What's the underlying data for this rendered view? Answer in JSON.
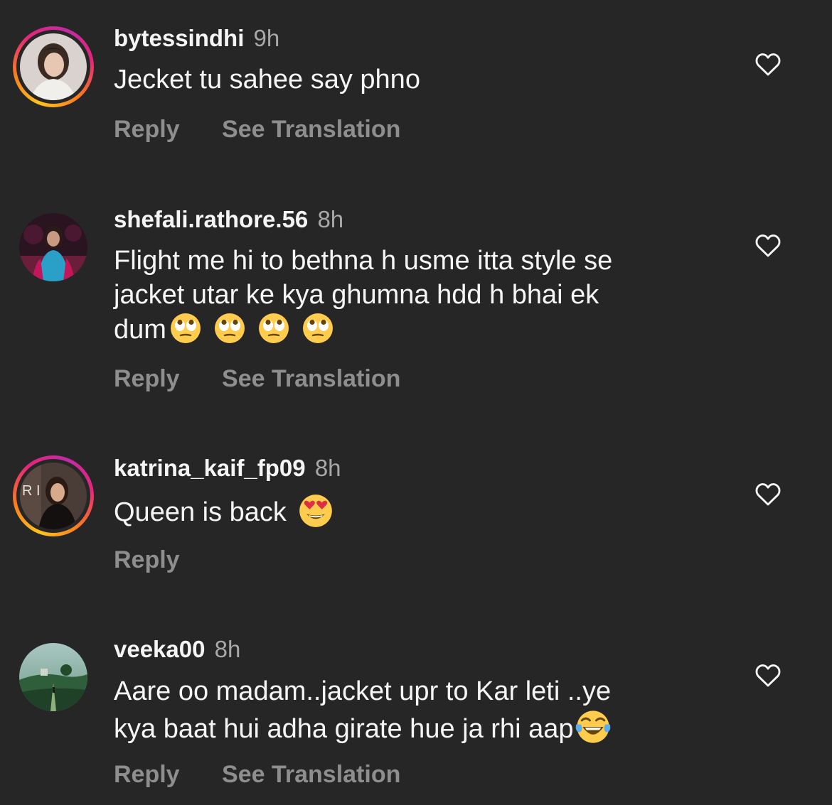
{
  "comments": [
    {
      "username": "bytessindhi",
      "time": "9h",
      "text_lines": [
        "Jecket tu sahee say phno"
      ],
      "reply_label": "Reply",
      "translation_label": "See Translation",
      "avatar_story_ring": true,
      "emojis": []
    },
    {
      "username": "shefali.rathore.56",
      "time": "8h",
      "text_lines": [
        "Flight me hi to bethna h usme itta style se",
        "jacket utar ke kya ghumna hdd h bhai ek",
        "dum"
      ],
      "reply_label": "Reply",
      "translation_label": "See Translation",
      "avatar_story_ring": false,
      "emojis": [
        "face-with-rolling-eyes",
        "face-with-rolling-eyes",
        "face-with-rolling-eyes",
        "face-with-rolling-eyes"
      ]
    },
    {
      "username": "katrina_kaif_fp09",
      "time": "8h",
      "text_lines": [
        "Queen is back"
      ],
      "reply_label": "Reply",
      "avatar_story_ring": true,
      "emojis": [
        "smiling-face-with-heart-eyes"
      ]
    },
    {
      "username": "veeka00",
      "time": "8h",
      "text_lines": [
        "Aare oo madam..jacket upr to Kar leti ..ye",
        "kya baat hui adha girate hue ja rhi aap"
      ],
      "reply_label": "Reply",
      "translation_label": "See Translation",
      "avatar_story_ring": false,
      "emojis": [
        "face-with-tears-of-joy"
      ]
    }
  ],
  "icons": {
    "like": "heart-outline-icon"
  },
  "colors": {
    "background": "#262626",
    "primary_text": "#f5f5f5",
    "secondary_text": "#a8a8a8",
    "action_text": "#8e8e8e",
    "story_ring": [
      "#ffc31a",
      "#f97a1f",
      "#e4267a",
      "#c32aa3"
    ]
  }
}
